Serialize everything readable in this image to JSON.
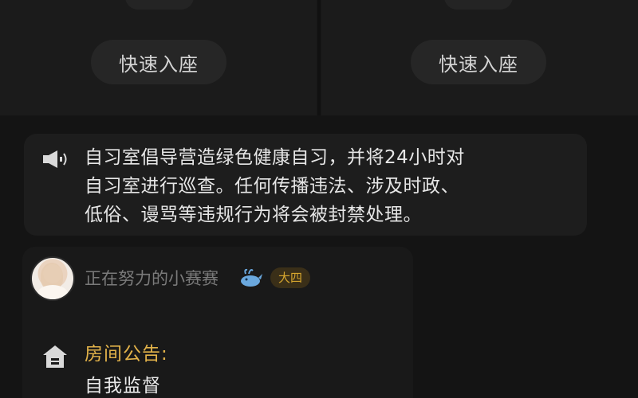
{
  "seats": [
    {
      "button_label": "快速入座"
    },
    {
      "button_label": "快速入座"
    }
  ],
  "notice": {
    "icon": "speaker-icon",
    "lines": [
      "自习室倡导营造绿色健康自习，并将24小时对",
      "自习室进行巡查。任何传播违法、涉及时政、",
      "低俗、谩骂等违规行为将会被封禁处理。"
    ]
  },
  "host": {
    "username": "正在努力的小赛赛",
    "badge_icon": "whale-icon",
    "grade": "大四"
  },
  "announcement": {
    "icon": "house-icon",
    "title": "房间公告:",
    "body": "自我监督"
  },
  "colors": {
    "background": "#141414",
    "announcement_title": "#e3b34a",
    "grade_badge_text": "#d6a62e"
  }
}
